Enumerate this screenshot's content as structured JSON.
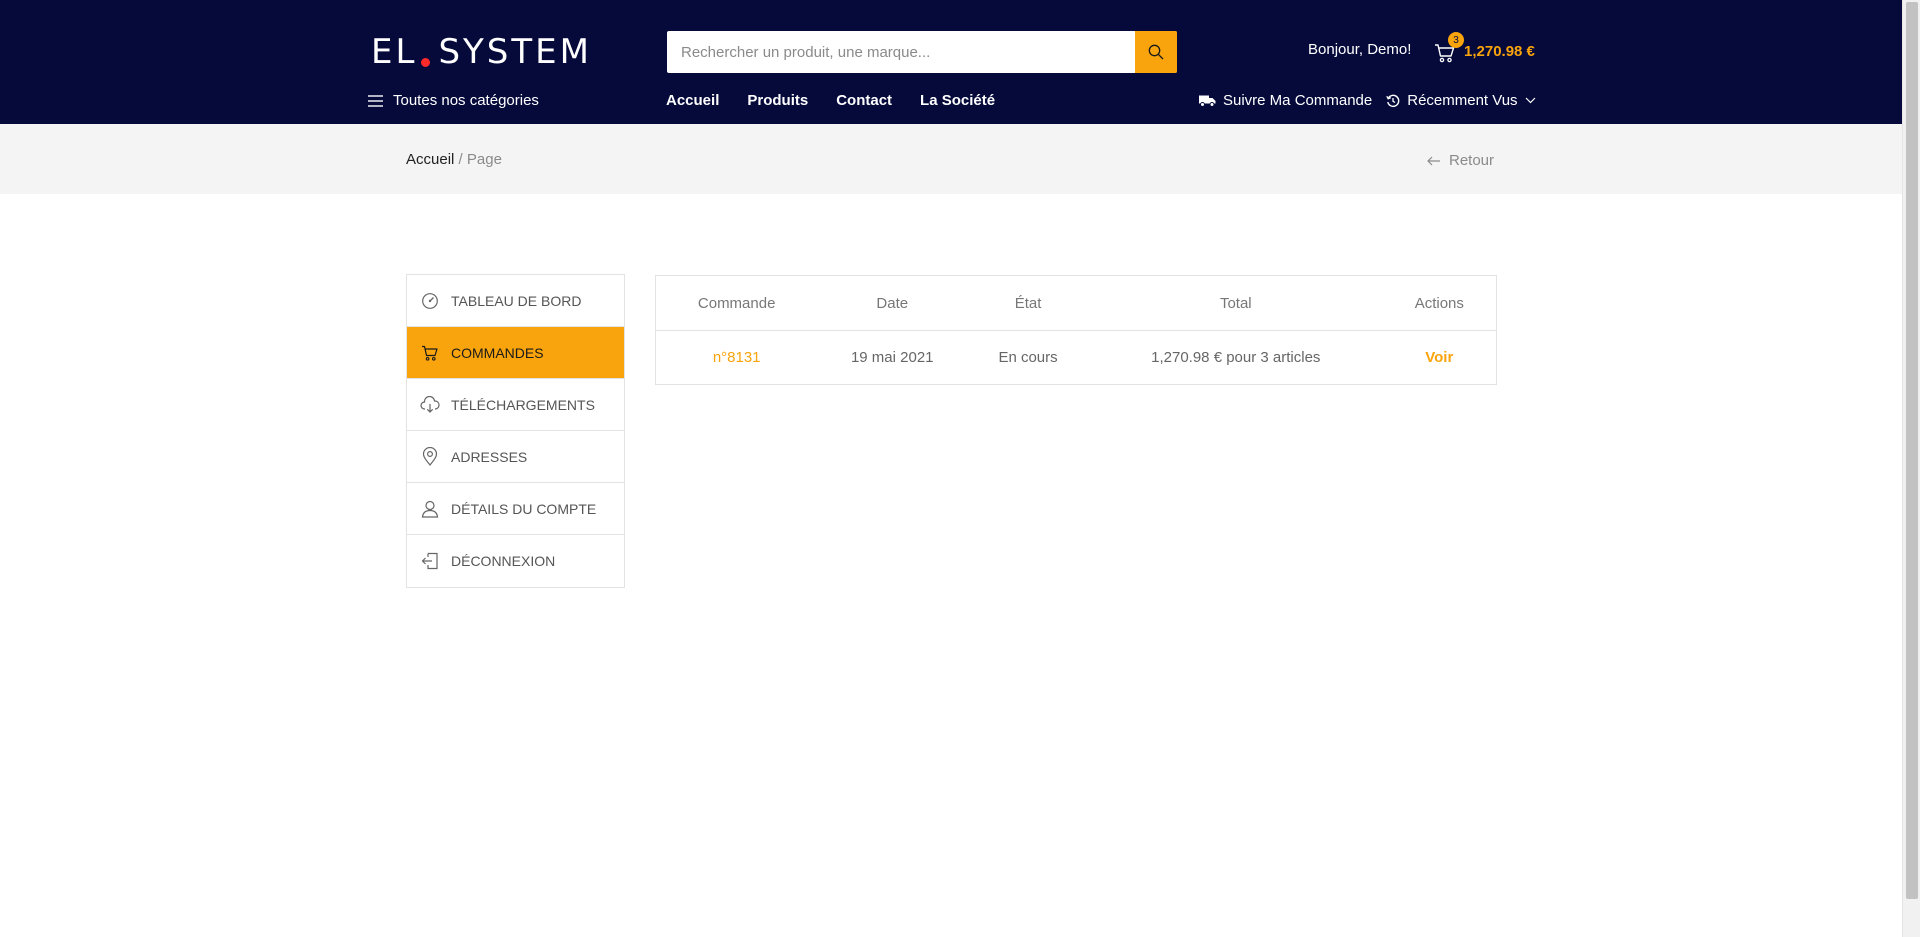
{
  "header": {
    "logo_left": "EL",
    "logo_right": "SYSTEM",
    "search_placeholder": "Rechercher un produit, une marque...",
    "greeting": "Bonjour, Demo!",
    "cart_count": "3",
    "cart_total": "1,270.98 €",
    "categories_label": "Toutes nos catégories",
    "nav": [
      "Accueil",
      "Produits",
      "Contact",
      "La Société"
    ],
    "track_order": "Suivre Ma Commande",
    "recently_viewed": "Récemment Vus"
  },
  "breadcrumb": {
    "home": "Accueil",
    "separator": "/",
    "current": "Page",
    "back": "Retour"
  },
  "account_menu": [
    {
      "label": "TABLEAU DE BORD",
      "icon": "dashboard-icon",
      "active": false
    },
    {
      "label": "COMMANDES",
      "icon": "cart-icon",
      "active": true
    },
    {
      "label": "TÉLÉCHARGEMENTS",
      "icon": "cloud-download-icon",
      "active": false
    },
    {
      "label": "ADRESSES",
      "icon": "map-pin-icon",
      "active": false
    },
    {
      "label": "DÉTAILS DU COMPTE",
      "icon": "user-icon",
      "active": false
    },
    {
      "label": "DÉCONNEXION",
      "icon": "logout-icon",
      "active": false
    }
  ],
  "orders": {
    "columns": [
      "Commande",
      "Date",
      "État",
      "Total",
      "Actions"
    ],
    "rows": [
      {
        "number": "n°8131",
        "date": "19 mai 2021",
        "status": "En cours",
        "total": "1,270.98 € pour 3 articles",
        "action": "Voir"
      }
    ]
  },
  "colors": {
    "header_bg": "#050a3b",
    "accent": "#f9a40c",
    "logo_dot": "#ff2a2a"
  }
}
